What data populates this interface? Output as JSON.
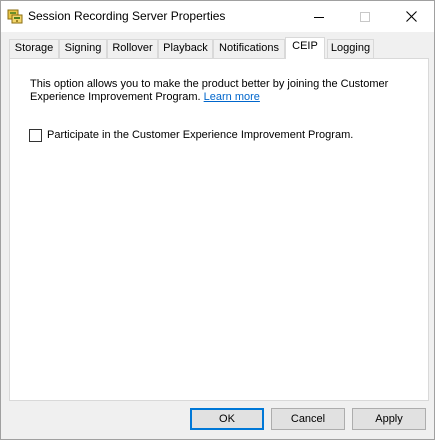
{
  "window": {
    "title": "Session Recording Server Properties",
    "app_icon": "session-recording-app-icon",
    "controls": {
      "minimize_icon": "minimize-icon",
      "maximize_icon": "maximize-icon",
      "close_icon": "close-icon"
    }
  },
  "tabs": [
    {
      "label": "Storage",
      "active": false
    },
    {
      "label": "Signing",
      "active": false
    },
    {
      "label": "Rollover",
      "active": false
    },
    {
      "label": "Playback",
      "active": false
    },
    {
      "label": "Notifications",
      "active": false
    },
    {
      "label": "CEIP",
      "active": true
    },
    {
      "label": "Logging",
      "active": false
    }
  ],
  "panel": {
    "description": "This option allows you to make the product better by joining the Customer Experience Improvement Program.",
    "learn_more": "Learn more",
    "checkbox_label": "Participate in the Customer Experience Improvement Program.",
    "checkbox_checked": false
  },
  "buttons": {
    "ok": "OK",
    "cancel": "Cancel",
    "apply": "Apply"
  },
  "colors": {
    "link": "#0066cc",
    "default_button_border": "#0078d7",
    "dialog_background": "#f0f0f0"
  }
}
